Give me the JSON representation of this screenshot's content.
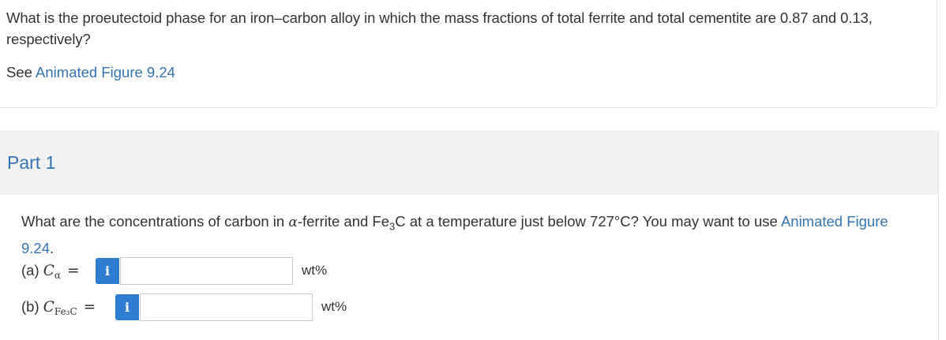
{
  "question": {
    "text": "What is the proeutectoid phase for an iron–carbon alloy in which the mass fractions of total ferrite and total cementite are 0.87 and 0.13, respectively?",
    "see_prefix": "See",
    "see_link": "Animated Figure 9.24"
  },
  "part1": {
    "title": "Part 1",
    "prompt_before_alpha": "What are the concentrations of carbon in ",
    "alpha_symbol": "α",
    "prompt_middle": "-ferrite and Fe",
    "prompt_sub": "3",
    "prompt_after": "C at a temperature just below 727°C? You may want to use ",
    "prompt_link": "Animated Figure 9.24",
    "prompt_end": ".",
    "answers": [
      {
        "prefix": "(a) ",
        "var": "C",
        "sub": "α",
        "equals": "=",
        "info": "i",
        "value": "",
        "unit": "wt%"
      },
      {
        "prefix": "(b) ",
        "var": "C",
        "sub": "Fe₃C",
        "equals": "=",
        "info": "i",
        "value": "",
        "unit": "wt%"
      }
    ]
  },
  "colors": {
    "link": "#3474b3",
    "info_button": "#2f7dd1",
    "part_header_bg": "#f2f2f2"
  }
}
